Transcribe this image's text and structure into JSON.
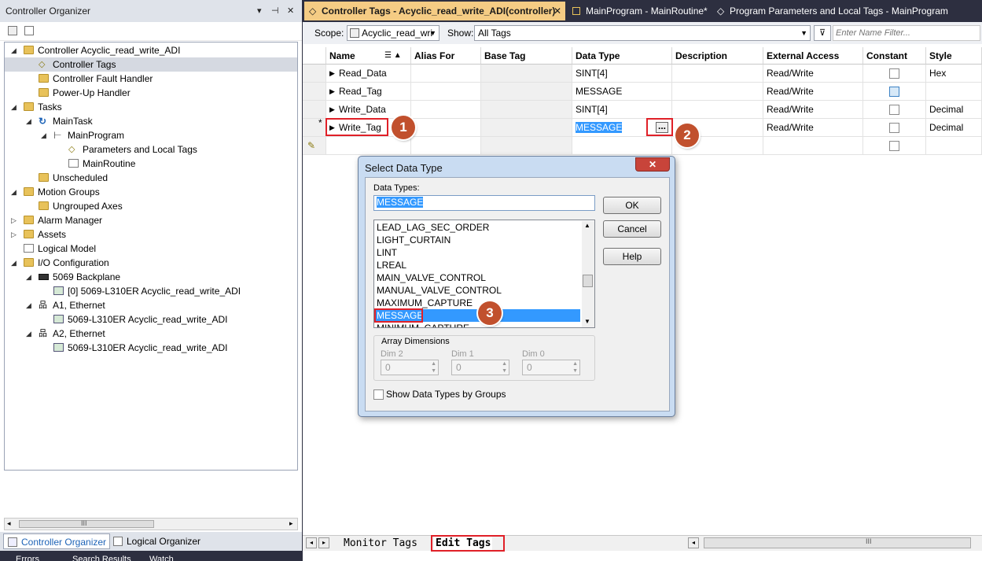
{
  "left_pane": {
    "title": "Controller Organizer",
    "pin_glyph": "▾",
    "autohide_glyph": "⊣",
    "close_glyph": "✕",
    "tree": [
      {
        "label": "Controller Acyclic_read_write_ADI",
        "icon": "folder-open-icon"
      },
      {
        "label": "Controller Tags",
        "icon": "tag-icon",
        "selected": true
      },
      {
        "label": "Controller Fault Handler",
        "icon": "folder-icon"
      },
      {
        "label": "Power-Up Handler",
        "icon": "folder-icon"
      },
      {
        "label": "Tasks",
        "icon": "folder-open-icon"
      },
      {
        "label": "MainTask",
        "icon": "task-icon"
      },
      {
        "label": "MainProgram",
        "icon": "program-icon"
      },
      {
        "label": "Parameters and Local Tags",
        "icon": "tag-icon"
      },
      {
        "label": "MainRoutine",
        "icon": "routine-icon"
      },
      {
        "label": "Unscheduled",
        "icon": "folder-icon"
      },
      {
        "label": "Motion Groups",
        "icon": "folder-open-icon"
      },
      {
        "label": "Ungrouped Axes",
        "icon": "folder-icon"
      },
      {
        "label": "Alarm Manager",
        "icon": "folder-icon"
      },
      {
        "label": "Assets",
        "icon": "folder-icon"
      },
      {
        "label": "Logical Model",
        "icon": "model-icon"
      },
      {
        "label": "I/O Configuration",
        "icon": "folder-open-icon"
      },
      {
        "label": "5069 Backplane",
        "icon": "backplane-icon"
      },
      {
        "label": "[0] 5069-L310ER Acyclic_read_write_ADI",
        "icon": "module-icon"
      },
      {
        "label": "A1, Ethernet",
        "icon": "network-icon"
      },
      {
        "label": "5069-L310ER Acyclic_read_write_ADI",
        "icon": "module-icon"
      },
      {
        "label": "A2, Ethernet",
        "icon": "network-icon"
      },
      {
        "label": "5069-L310ER Acyclic_read_write_ADI",
        "icon": "module-icon"
      }
    ],
    "scroll_mark": "III",
    "tabs": {
      "controller_organizer": "Controller Organizer",
      "logical_organizer": "Logical Organizer"
    }
  },
  "bottom_strip": {
    "errors": "Errors",
    "search_results": "Search Results",
    "watch": "Watch"
  },
  "doc_tabs": [
    {
      "label": "Controller Tags - Acyclic_read_write_ADI(controller)",
      "icon": "tag-icon",
      "active": true
    },
    {
      "label": "MainProgram - MainRoutine*",
      "icon": "routine-icon"
    },
    {
      "label": "Program Parameters and Local Tags - MainProgram",
      "icon": "tag-icon"
    }
  ],
  "doc_tab_close": "✕",
  "scope_bar": {
    "scope_label": "Scope:",
    "scope_value": "Acyclic_read_wri",
    "show_label": "Show:",
    "show_value": "All Tags",
    "filter_placeholder": "Enter Name Filter..."
  },
  "grid": {
    "columns": [
      "Name",
      "Alias For",
      "Base Tag",
      "Data Type",
      "Description",
      "External Access",
      "Constant",
      "Style"
    ],
    "rows": [
      {
        "name": "Read_Data",
        "alias": "",
        "base": "",
        "type": "SINT[4]",
        "desc": "",
        "access": "Read/Write",
        "constant": false,
        "style": "Hex"
      },
      {
        "name": "Read_Tag",
        "alias": "",
        "base": "",
        "type": "MESSAGE",
        "desc": "",
        "access": "Read/Write",
        "constant": true,
        "style": ""
      },
      {
        "name": "Write_Data",
        "alias": "",
        "base": "",
        "type": "SINT[4]",
        "desc": "",
        "access": "Read/Write",
        "constant": false,
        "style": "Decimal"
      },
      {
        "name": "Write_Tag",
        "alias": "",
        "base": "",
        "type": "MESSAGE",
        "desc": "",
        "access": "Read/Write",
        "constant": false,
        "style": "Decimal",
        "marker": "*"
      }
    ],
    "new_row_marker": "✎",
    "ellipsis": "..."
  },
  "badges": [
    "1",
    "2",
    "3"
  ],
  "edit_tabs": {
    "monitor": "Monitor Tags",
    "edit": "Edit Tags",
    "scroll_mark": "III"
  },
  "dialog": {
    "title": "Select Data Type",
    "close": "✕",
    "data_types_label": "Data Types:",
    "input_value": "MESSAGE",
    "list": [
      "LEAD_LAG_SEC_ORDER",
      "LIGHT_CURTAIN",
      "LINT",
      "LREAL",
      "MAIN_VALVE_CONTROL",
      "MANUAL_VALVE_CONTROL",
      "MAXIMUM_CAPTURE",
      "MESSAGE",
      "MINIMUM_CAPTURE"
    ],
    "selected": "MESSAGE",
    "buttons": {
      "ok": "OK",
      "cancel": "Cancel",
      "help": "Help"
    },
    "array_dimensions": "Array Dimensions",
    "dims": [
      {
        "label": "Dim 2",
        "value": "0"
      },
      {
        "label": "Dim 1",
        "value": "0"
      },
      {
        "label": "Dim 0",
        "value": "0"
      }
    ],
    "show_by_groups": "Show Data Types by Groups"
  }
}
